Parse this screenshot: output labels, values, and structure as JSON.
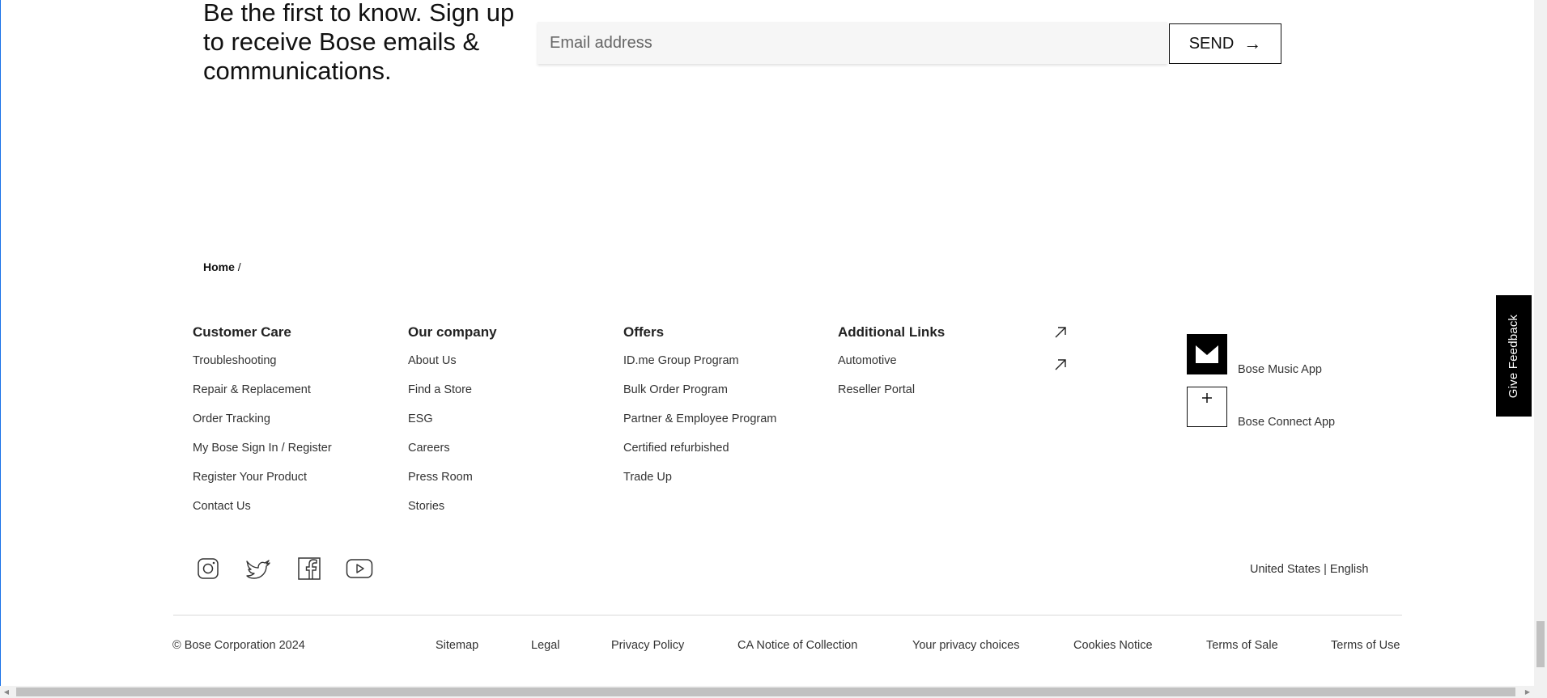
{
  "newsletter": {
    "headline": "Be the first to know. Sign up to receive Bose emails & communications.",
    "email_placeholder": "Email address",
    "send_label": "SEND",
    "send_arrow": "→"
  },
  "breadcrumb": {
    "home": "Home",
    "separator": "/"
  },
  "footer": {
    "customer_care": {
      "title": "Customer Care",
      "links": [
        "Troubleshooting",
        "Repair & Replacement",
        "Order Tracking",
        "My Bose Sign In / Register",
        "Register Your Product",
        "Contact Us"
      ]
    },
    "our_company": {
      "title": "Our company",
      "links": [
        "About Us",
        "Find a Store",
        "ESG",
        "Careers",
        "Press Room",
        "Stories"
      ]
    },
    "offers": {
      "title": "Offers",
      "links": [
        "ID.me Group Program",
        "Bulk Order Program",
        "Partner & Employee Program",
        "Certified refurbished",
        "Trade Up"
      ]
    },
    "additional_links": {
      "title": "Additional Links",
      "links": [
        "Automotive",
        "Reseller Portal"
      ]
    },
    "apps": [
      {
        "label": "Bose Music App",
        "icon": "bose-music-app-icon"
      },
      {
        "label": "Bose Connect App",
        "icon": "bose-connect-app-icon"
      }
    ],
    "social": [
      "instagram-icon",
      "twitter-icon",
      "facebook-icon",
      "youtube-icon"
    ],
    "locale": {
      "country": "United States",
      "separator": "|",
      "language": "English"
    },
    "copyright": "© Bose Corporation 2024",
    "legal_links": [
      "Sitemap",
      "Legal",
      "Privacy Policy",
      "CA Notice of Collection",
      "Your privacy choices",
      "Cookies Notice",
      "Terms of Sale",
      "Terms of Use"
    ]
  },
  "feedback": {
    "label": "Give Feedback"
  },
  "colors": {
    "accent": "#000000",
    "input_bg": "#f6f6f6",
    "divider": "#d9d9d9"
  }
}
